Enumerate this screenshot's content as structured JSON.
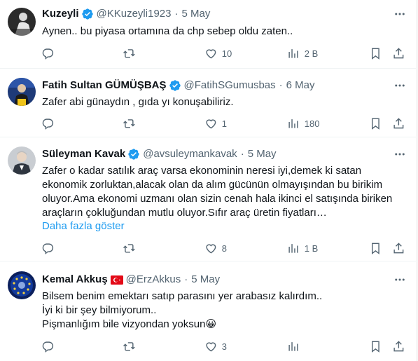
{
  "tweets": [
    {
      "name": "Kuzeyli",
      "handle": "@KKuzeyli1923",
      "separator": "·",
      "time": "5 May",
      "text": [
        "Aynen.. bu piyasa ortamına da chp sebep oldu zaten.."
      ],
      "replies": "",
      "retweets": "",
      "likes": "10",
      "views": "2 B",
      "verified": true
    },
    {
      "name": "Fatih Sultan GÜMÜŞBAŞ",
      "handle": "@FatihSGumusbas",
      "separator": "·",
      "time": "6 May",
      "text": [
        "Zafer abi günaydın , gıda yı konuşabiliriz."
      ],
      "replies": "",
      "retweets": "",
      "likes": "1",
      "views": "180",
      "verified": true
    },
    {
      "name": "Süleyman Kavak",
      "handle": "@avsuleymankavak",
      "separator": "·",
      "time": "5 May",
      "text": [
        "Zafer o kadar satılık araç varsa ekonominin neresi iyi,demek ki satan",
        "ekonomik zorluktan,alacak olan da alım gücünün olmayışından bu birikim",
        "oluyor.Ama ekonomi uzmanı olan sizin cenah hala ikinci el satışında biriken",
        "araçların çokluğundan mutlu oluyor.Sıfır araç üretin fiyatları…"
      ],
      "show_more": "Daha fazla göster",
      "replies": "",
      "retweets": "",
      "likes": "8",
      "views": "1 B",
      "verified": true
    },
    {
      "name": "Kemal Akkuş",
      "handle": "@ErzAkkus",
      "separator": "·",
      "time": "5 May",
      "text": [
        "Bilsem benim emektarı satıp parasını yer arabasız kalırdım..",
        "İyi ki bir şey bilmiyorum..",
        "Pişmanlığım bile vizyondan yoksun😀"
      ],
      "replies": "",
      "retweets": "",
      "likes": "3",
      "views": "",
      "verified": false,
      "flag": "turkey-flag"
    }
  ],
  "colors": {
    "text": "#0f1419",
    "secondary": "#536471",
    "link": "#1d9bf0",
    "verified": "#1d9bf0",
    "divider": "#eff3f4"
  },
  "icons": [
    "reply-icon",
    "retweet-icon",
    "heart-icon",
    "views-icon",
    "bookmark-icon",
    "share-icon",
    "more-icon",
    "verified-badge-icon"
  ]
}
